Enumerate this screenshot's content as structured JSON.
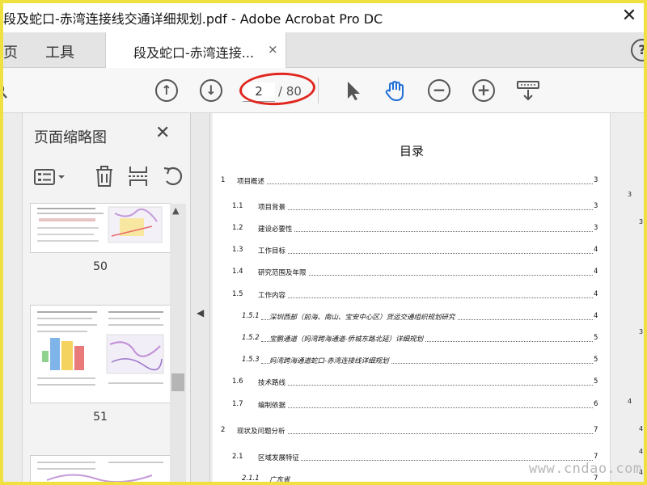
{
  "window": {
    "title": "段及蛇口-赤湾连接线交通详细规划.pdf - Adobe Acrobat Pro DC",
    "close_glyph": "✕"
  },
  "tabs": {
    "home": "页",
    "tools": "工具",
    "document": "段及蛇口-赤湾连接...",
    "close_glyph": "×",
    "help_glyph": "?"
  },
  "toolbar": {
    "current_page": "2",
    "total_pages": "/ 80"
  },
  "thumbnails": {
    "title": "页面缩略图",
    "close_glyph": "✕",
    "pages": [
      {
        "number": "50"
      },
      {
        "number": "51"
      }
    ]
  },
  "document": {
    "heading": "目录",
    "toc": [
      {
        "num": "1",
        "text": "项目概述",
        "page": "3"
      },
      {
        "num": "1.1",
        "text": "项目背景",
        "page": "3"
      },
      {
        "num": "1.2",
        "text": "建设必要性",
        "page": "3"
      },
      {
        "num": "1.3",
        "text": "工作目标",
        "page": "4"
      },
      {
        "num": "1.4",
        "text": "研究范围及年限",
        "page": "4"
      },
      {
        "num": "1.5",
        "text": "工作内容",
        "page": "4"
      },
      {
        "num": "1.5.1",
        "text": "深圳西部（前海、南山、宝安中心区）货运交通组织规划研究",
        "page": "4"
      },
      {
        "num": "1.5.2",
        "text": "宝鹏通道（妈湾跨海通道-侨城东路北延）详细规划",
        "page": "5"
      },
      {
        "num": "1.5.3",
        "text": "妈湾跨海通道蛇口-赤湾连接线详细规划",
        "page": "5"
      },
      {
        "num": "1.6",
        "text": "技术路线",
        "page": "5"
      },
      {
        "num": "1.7",
        "text": "编制依据",
        "page": "6"
      },
      {
        "num": "2",
        "text": "现状及问题分析",
        "page": "7"
      },
      {
        "num": "2.1",
        "text": "区域发展特征",
        "page": "7"
      },
      {
        "num": "2.1.1",
        "text": "广东省",
        "page": "7"
      }
    ],
    "side_numbers": [
      "3",
      "3.",
      "3.",
      "4",
      "4.",
      "4.",
      "4."
    ]
  },
  "watermark": "www.cndao.com"
}
